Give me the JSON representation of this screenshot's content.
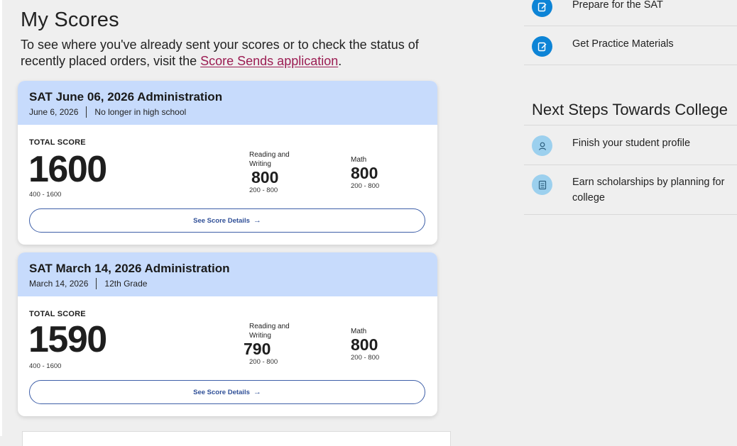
{
  "page_title": "My Scores",
  "intro": {
    "text": "To see where you've already sent your scores or to check the status of recently placed orders, visit the ",
    "link": "Score Sends application",
    "end": "."
  },
  "scores": [
    {
      "title": "SAT June 06, 2026 Administration",
      "date": "June 6, 2026",
      "status": "No longer in high school",
      "total_label": "TOTAL SCORE",
      "total": "1600",
      "total_range": "400 - 1600",
      "rw_label": "Reading and Writing",
      "rw_value": "800",
      "rw_range": "200 - 800",
      "math_label": "Math",
      "math_value": "800",
      "math_range": "200 - 800",
      "details_label": "See Score Details"
    },
    {
      "title": "SAT March 14, 2026 Administration",
      "date": "March 14, 2026",
      "status": "12th Grade",
      "total_label": "TOTAL SCORE",
      "total": "1590",
      "total_range": "400 - 1600",
      "rw_label": "Reading and Writing",
      "rw_value": "790",
      "rw_range": "200 - 800",
      "math_label": "Math",
      "math_value": "800",
      "math_range": "200 - 800",
      "details_label": "See Score Details"
    }
  ],
  "sidebar": {
    "top_items": [
      {
        "label": "Prepare for the SAT",
        "icon": "edit-icon"
      },
      {
        "label": "Get Practice Materials",
        "icon": "edit-icon"
      }
    ],
    "next_steps_title": "Next Steps Towards College",
    "next_steps": [
      {
        "label": "Finish your student profile",
        "icon": "user-icon"
      },
      {
        "label": "Earn scholarships by planning for college",
        "icon": "checklist-icon"
      }
    ]
  },
  "colors": {
    "card_header": "#c7dbfc",
    "link": "#9b1c52",
    "button_border": "#3e5fa8",
    "icon_blue": "#0d84d6",
    "icon_light": "#9cd0ee"
  }
}
